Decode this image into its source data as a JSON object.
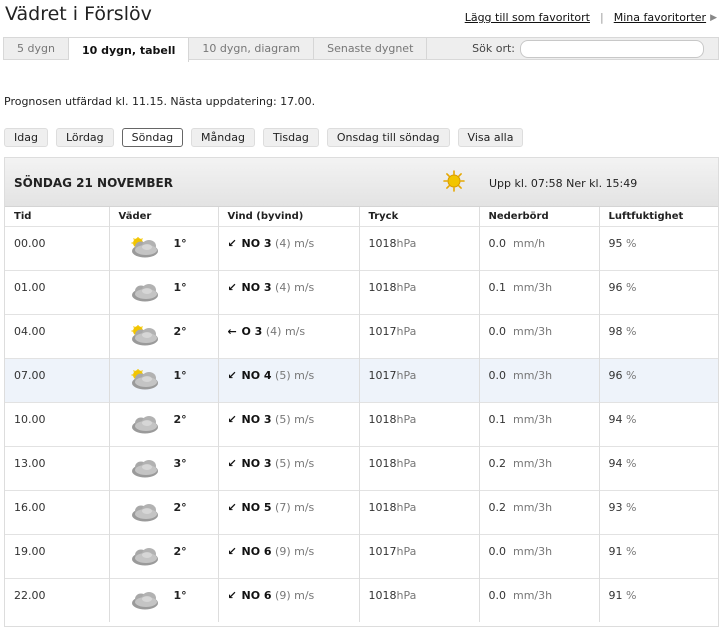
{
  "page": {
    "title": "Vädret i Förslöv"
  },
  "toplinks": {
    "add_fav": "Lägg till som favoritort",
    "separator": "|",
    "my_favs": "Mina favoritorter"
  },
  "tabs": [
    "5 dygn",
    "10 dygn, tabell",
    "10 dygn, diagram",
    "Senaste dygnet"
  ],
  "active_tab": "10 dygn, tabell",
  "search": {
    "label": "Sök ort:",
    "value": ""
  },
  "forecast_note": "Prognosen utfärdad kl. 11.15. Nästa uppdatering: 17.00.",
  "days": [
    "Idag",
    "Lördag",
    "Söndag",
    "Måndag",
    "Tisdag",
    "Onsdag till söndag",
    "Visa alla"
  ],
  "active_day": "Söndag",
  "day_header": {
    "date": "SÖNDAG 21 NOVEMBER",
    "sun": "Upp kl. 07:58 Ner kl. 15:49",
    "sun_icon": "sun-icon"
  },
  "columns": [
    "Tid",
    "Väder",
    "Vind (byvind)",
    "Tryck",
    "Nederbörd",
    "Luftfuktighet"
  ],
  "units": {
    "gust": "m/s",
    "pressure": "hPa",
    "humidity": "%"
  },
  "colors": {
    "highlight_row": "#eef3fa",
    "sun": "#f2c500"
  },
  "rows": [
    {
      "time": "00.00",
      "icon": "sun-behind-cloud-icon",
      "temp": "1°",
      "arrow": "↙",
      "dir": "NO 3",
      "gust": "(4)",
      "pressure": "1018",
      "precip": "0.0",
      "precip_unit": "mm/h",
      "humidity": "95"
    },
    {
      "time": "01.00",
      "icon": "cloud-icon",
      "temp": "1°",
      "arrow": "↙",
      "dir": "NO 3",
      "gust": "(4)",
      "pressure": "1018",
      "precip": "0.1",
      "precip_unit": "mm/3h",
      "humidity": "96"
    },
    {
      "time": "04.00",
      "icon": "sun-behind-cloud-icon",
      "temp": "2°",
      "arrow": "←",
      "dir": "O 3",
      "gust": "(4)",
      "pressure": "1017",
      "precip": "0.0",
      "precip_unit": "mm/3h",
      "humidity": "98"
    },
    {
      "time": "07.00",
      "icon": "sun-behind-cloud-icon",
      "temp": "1°",
      "arrow": "↙",
      "dir": "NO 4",
      "gust": "(5)",
      "pressure": "1017",
      "precip": "0.0",
      "precip_unit": "mm/3h",
      "humidity": "96",
      "highlight": true
    },
    {
      "time": "10.00",
      "icon": "cloud-icon",
      "temp": "2°",
      "arrow": "↙",
      "dir": "NO 3",
      "gust": "(5)",
      "pressure": "1018",
      "precip": "0.1",
      "precip_unit": "mm/3h",
      "humidity": "94"
    },
    {
      "time": "13.00",
      "icon": "cloud-icon",
      "temp": "3°",
      "arrow": "↙",
      "dir": "NO 3",
      "gust": "(5)",
      "pressure": "1018",
      "precip": "0.2",
      "precip_unit": "mm/3h",
      "humidity": "94"
    },
    {
      "time": "16.00",
      "icon": "cloud-icon",
      "temp": "2°",
      "arrow": "↙",
      "dir": "NO 5",
      "gust": "(7)",
      "pressure": "1018",
      "precip": "0.2",
      "precip_unit": "mm/3h",
      "humidity": "93"
    },
    {
      "time": "19.00",
      "icon": "cloud-icon",
      "temp": "2°",
      "arrow": "↙",
      "dir": "NO 6",
      "gust": "(9)",
      "pressure": "1017",
      "precip": "0.0",
      "precip_unit": "mm/3h",
      "humidity": "91"
    },
    {
      "time": "22.00",
      "icon": "cloud-icon",
      "temp": "1°",
      "arrow": "↙",
      "dir": "NO 6",
      "gust": "(9)",
      "pressure": "1018",
      "precip": "0.0",
      "precip_unit": "mm/3h",
      "humidity": "91"
    }
  ]
}
